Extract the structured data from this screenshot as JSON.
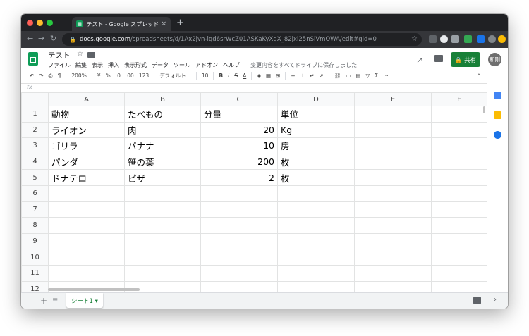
{
  "browser": {
    "tab_title": "テスト - Google スプレッドシート",
    "tab_close": "×",
    "new_tab": "+",
    "url_host": "docs.google.com",
    "url_path": "/spreadsheets/d/1Ax2jvn-lqd6srWcZ01ASKaKyXgX_82jxi25nSiVmOWA/edit#gid=0",
    "back": "←",
    "forward": "→",
    "reload": "↻",
    "star": "☆"
  },
  "doc": {
    "title": "テスト",
    "star": "☆",
    "menus": [
      "ファイル",
      "編集",
      "表示",
      "挿入",
      "表示形式",
      "データ",
      "ツール",
      "アドオン",
      "ヘルプ"
    ],
    "save_status": "変更内容をすべてドライブに保存しました",
    "share_label": "🔒 共有",
    "avatar_text": "和剛"
  },
  "toolbar": {
    "undo": "↶",
    "redo": "↷",
    "print": "⎙",
    "paint": "¶",
    "zoom": "200%",
    "currency": "¥",
    "percent": "%",
    "dec_less": ".0",
    "dec_more": ".00",
    "format_more": "123",
    "font": "デフォルト...",
    "font_size": "10",
    "bold": "B",
    "italic": "I",
    "strike": "S",
    "text_color": "A",
    "more": "⋯",
    "collapse": "⌃"
  },
  "formula_bar": {
    "fx": "fx"
  },
  "grid": {
    "columns": [
      "A",
      "B",
      "C",
      "D",
      "E",
      "F"
    ],
    "rows": [
      {
        "num": "1",
        "cells": [
          "動物",
          "たべもの",
          "分量",
          "単位",
          "",
          ""
        ]
      },
      {
        "num": "2",
        "cells": [
          "ライオン",
          "肉",
          "20",
          "Kg",
          "",
          ""
        ]
      },
      {
        "num": "3",
        "cells": [
          "ゴリラ",
          "バナナ",
          "10",
          "房",
          "",
          ""
        ]
      },
      {
        "num": "4",
        "cells": [
          "パンダ",
          "笹の葉",
          "200",
          "枚",
          "",
          ""
        ]
      },
      {
        "num": "5",
        "cells": [
          "ドナテロ",
          "ピザ",
          "2",
          "枚",
          "",
          ""
        ]
      },
      {
        "num": "6",
        "cells": [
          "",
          "",
          "",
          "",
          "",
          ""
        ]
      },
      {
        "num": "7",
        "cells": [
          "",
          "",
          "",
          "",
          "",
          ""
        ]
      },
      {
        "num": "8",
        "cells": [
          "",
          "",
          "",
          "",
          "",
          ""
        ]
      },
      {
        "num": "9",
        "cells": [
          "",
          "",
          "",
          "",
          "",
          ""
        ]
      },
      {
        "num": "10",
        "cells": [
          "",
          "",
          "",
          "",
          "",
          ""
        ]
      },
      {
        "num": "11",
        "cells": [
          "",
          "",
          "",
          "",
          "",
          ""
        ]
      },
      {
        "num": "12",
        "cells": [
          "",
          "",
          "",
          "",
          "",
          ""
        ]
      }
    ]
  },
  "bottom": {
    "add_sheet": "+",
    "all_sheets": "≡",
    "sheet_tab": "シート1 ▾",
    "side_chevron": "›"
  },
  "colors": {
    "sheets_green": "#0f9d58",
    "share_green": "#188038",
    "chrome_dark": "#202124"
  }
}
